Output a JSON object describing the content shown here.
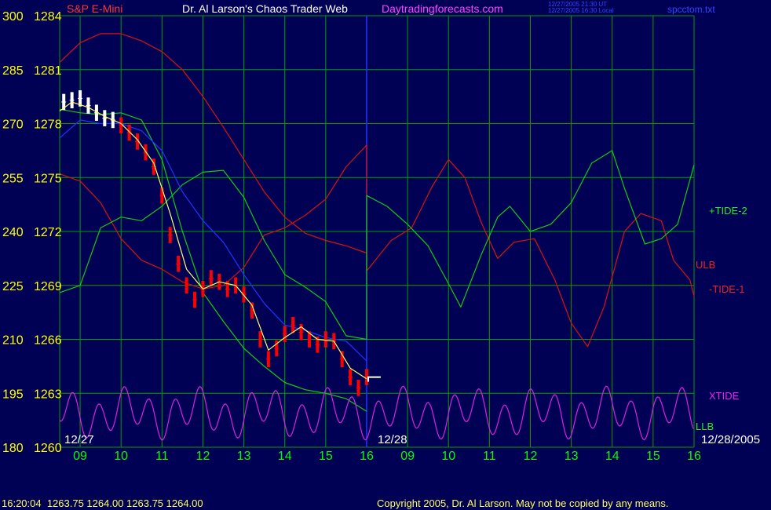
{
  "header": {
    "instrument": "S&P E-Mini",
    "title": "Dr. Al Larson's Chaos Trader Web",
    "site": "Daytradingforecasts.com",
    "stamp_line1": "12/27/2005 21:30 UT",
    "stamp_line2": "12/27/2005 16:30 Local",
    "filename": "spcctom.txt"
  },
  "footer": {
    "quote": "16:20:04  1263.75 1264.00 1263.75 1264.00",
    "copyright": "Copyright 2005, Dr. Al Larson. May not be copied by any means."
  },
  "colors": {
    "background": "#000055",
    "grid": "#00a000",
    "price_bar": "#ff0000",
    "price_bar_early": "#ffffff",
    "price_smooth": "#ffff66",
    "blue_line": "#2233ff",
    "red_tide": "#dd1111",
    "green_tide": "#11cc11",
    "xtide": "#dd22dd",
    "axis_yellow": "#ffff00",
    "time_green": "#00ff00"
  },
  "chart_data": {
    "type": "line",
    "left_axis_labels": [
      "300",
      "285",
      "270",
      "255",
      "240",
      "225",
      "210",
      "195",
      "180"
    ],
    "price_axis_labels": [
      "1284",
      "1281",
      "1278",
      "1275",
      "1272",
      "1269",
      "1266",
      "1263",
      "1260"
    ],
    "price_range": [
      1260,
      1284
    ],
    "left_range": [
      180,
      300
    ],
    "time_labels": [
      "09",
      "10",
      "11",
      "12",
      "13",
      "14",
      "15",
      "16",
      "09",
      "10",
      "11",
      "12",
      "13",
      "14",
      "15",
      "16"
    ],
    "date_labels": [
      "12/27",
      "12/28",
      "12/28/2005"
    ],
    "series_labels": {
      "tide2": "+TIDE-2",
      "ulb": "ULB",
      "tide1": "-TIDE-1",
      "xtide": "XTIDE",
      "llb": "LLB"
    },
    "price_bars": {
      "x_hours": [
        8.6,
        8.8,
        9.0,
        9.2,
        9.4,
        9.6,
        9.8,
        10.0,
        10.2,
        10.4,
        10.6,
        10.8,
        11.0,
        11.2,
        11.4,
        11.6,
        11.8,
        12.0,
        12.2,
        12.4,
        12.6,
        12.8,
        13.0,
        13.2,
        13.4,
        13.6,
        13.8,
        14.0,
        14.2,
        14.4,
        14.6,
        14.8,
        15.0,
        15.2,
        15.4,
        15.6,
        15.8,
        16.0
      ],
      "values": [
        1279.2,
        1279.3,
        1279.4,
        1279.0,
        1278.6,
        1278.3,
        1278.2,
        1277.9,
        1277.5,
        1277.0,
        1276.4,
        1275.6,
        1274.0,
        1271.8,
        1270.2,
        1269.0,
        1268.2,
        1268.8,
        1269.4,
        1269.2,
        1268.8,
        1269.0,
        1268.5,
        1267.6,
        1266.0,
        1264.9,
        1265.5,
        1266.3,
        1266.8,
        1266.4,
        1266.0,
        1265.7,
        1266.0,
        1265.9,
        1264.9,
        1263.9,
        1263.3,
        1263.9
      ]
    },
    "price_smooth": {
      "x_hours": [
        8.5,
        8.8,
        9.2,
        9.6,
        10.0,
        10.4,
        10.8,
        11.2,
        11.6,
        12.0,
        12.4,
        12.8,
        13.2,
        13.6,
        14.0,
        14.4,
        14.8,
        15.2,
        15.6,
        16.0
      ],
      "values": [
        1278.7,
        1279.2,
        1278.9,
        1278.4,
        1278.0,
        1277.1,
        1275.8,
        1273.0,
        1269.9,
        1268.8,
        1269.2,
        1269.0,
        1267.9,
        1265.4,
        1266.1,
        1266.7,
        1266.0,
        1265.9,
        1264.4,
        1263.8
      ]
    },
    "blue_line": {
      "x_hours": [
        8.5,
        9.0,
        9.5,
        10.0,
        10.5,
        11.0,
        11.5,
        12.0,
        12.5,
        13.0,
        13.5,
        14.0,
        14.5,
        15.0,
        15.5,
        16.0
      ],
      "values": [
        1277.2,
        1278.2,
        1278.0,
        1278.0,
        1277.6,
        1276.5,
        1274.2,
        1272.6,
        1271.4,
        1269.6,
        1268.0,
        1266.8,
        1266.5,
        1266.1,
        1265.9,
        1264.8
      ]
    },
    "ulb": {
      "x_hours": [
        8.5,
        9.0,
        9.5,
        10.0,
        10.5,
        11.0,
        11.5,
        12.0,
        12.5,
        13.0,
        13.5,
        14.0,
        14.5,
        15.0,
        15.5,
        16.0
      ],
      "values": [
        1281.4,
        1282.5,
        1283.0,
        1283.0,
        1282.6,
        1282.0,
        1281.0,
        1279.5,
        1277.8,
        1276.0,
        1274.2,
        1272.8,
        1271.9,
        1271.5,
        1271.2,
        1270.8
      ]
    },
    "llb": {
      "x_hours": [
        8.5,
        9.0,
        9.5,
        10.0,
        10.5,
        11.0,
        11.5,
        12.0,
        12.5,
        13.0,
        13.5,
        14.0,
        14.5,
        15.0,
        15.5,
        16.0
      ],
      "values": [
        1278.8,
        1278.6,
        1278.5,
        1278.6,
        1278.2,
        1276.0,
        1272.0,
        1268.6,
        1267.0,
        1265.5,
        1264.5,
        1263.6,
        1263.2,
        1263.0,
        1262.7,
        1262.0
      ]
    },
    "red_tide": {
      "x_hours": [
        8.5,
        9.0,
        9.5,
        10.0,
        10.5,
        11.0,
        11.5,
        12.0,
        12.5,
        13.0,
        13.5,
        14.0,
        14.5,
        15.0,
        15.5,
        16.0,
        16.0,
        16.6,
        17.1,
        17.6,
        18.0,
        18.4,
        18.8,
        19.2,
        19.6,
        20.1,
        20.6,
        21.0,
        21.4,
        21.8,
        22.3,
        22.7,
        23.2,
        23.5,
        23.9,
        24.0
      ],
      "values": [
        1275.2,
        1274.8,
        1273.6,
        1271.6,
        1270.4,
        1269.9,
        1269.2,
        1268.8,
        1269.0,
        1270.0,
        1271.8,
        1272.2,
        1272.9,
        1273.8,
        1275.6,
        1276.8,
        1269.8,
        1271.5,
        1272.2,
        1274.5,
        1276.0,
        1275.0,
        1272.5,
        1270.5,
        1271.4,
        1271.6,
        1269.3,
        1266.9,
        1265.6,
        1267.8,
        1272.0,
        1273.0,
        1272.6,
        1270.4,
        1269.3,
        1268.4
      ]
    },
    "green_tide": {
      "x_hours": [
        8.5,
        9.0,
        9.5,
        10.0,
        10.5,
        11.0,
        11.5,
        12.0,
        12.5,
        13.0,
        13.5,
        14.0,
        14.5,
        15.0,
        15.5,
        16.0,
        16.0,
        16.5,
        17.0,
        17.5,
        18.0,
        18.3,
        18.8,
        19.2,
        19.5,
        20.0,
        20.5,
        21.0,
        21.5,
        22.0,
        22.3,
        22.8,
        23.2,
        23.6,
        24.0
      ],
      "values": [
        1268.6,
        1269.0,
        1272.2,
        1272.8,
        1272.6,
        1273.4,
        1274.6,
        1275.3,
        1275.4,
        1273.9,
        1271.5,
        1269.6,
        1268.9,
        1268.1,
        1266.2,
        1266.0,
        1274.0,
        1273.4,
        1272.4,
        1271.2,
        1269.1,
        1267.8,
        1270.7,
        1272.8,
        1273.4,
        1272.0,
        1272.4,
        1273.6,
        1275.8,
        1276.5,
        1274.4,
        1271.3,
        1271.6,
        1272.4,
        1275.7
      ]
    },
    "xtide": {
      "x_hours": [
        8.5,
        24.0
      ],
      "period_hours": 0.62,
      "values_range": [
        1260.4,
        1263.4
      ]
    }
  }
}
